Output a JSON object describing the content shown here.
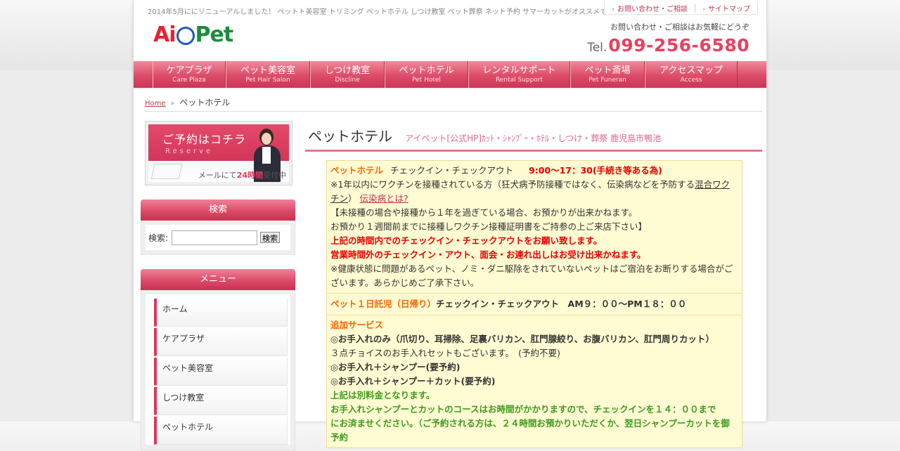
{
  "header": {
    "ticker": "2014年5月ににリニューアルしました！ ペットト美容室 トリミング ペットホテル しつけ教室 ペット葬祭 ネット予約 サマーカットがオススメです★ トリマー募集中!!",
    "links": [
      "お問い合わせ・ご相談",
      "サイトマップ"
    ],
    "logo": {
      "ai": "Ai",
      "pet": "Pet"
    },
    "contact_note": "お問い合わせ・ご相談はお気軽にどうぞ",
    "tel_label": "Tel.",
    "tel_number": "099-256-6580"
  },
  "nav": [
    {
      "jp": "ケアプラザ",
      "en": "Care Plaza"
    },
    {
      "jp": "ペット美容室",
      "en": "Pet Hair Salon"
    },
    {
      "jp": "しつけ教室",
      "en": "Discline"
    },
    {
      "jp": "ペットホテル",
      "en": "Pet Hotel"
    },
    {
      "jp": "レンタルサポート",
      "en": "Rental Support"
    },
    {
      "jp": "ペット斎場",
      "en": "Pet Funeran"
    },
    {
      "jp": "アクセスマップ",
      "en": "Access"
    }
  ],
  "breadcrumb": {
    "home": "Home",
    "separator": "»",
    "current": "ペットホテル"
  },
  "sidebar": {
    "reserve": {
      "title": "ご予約はコチラ",
      "sub": "Reserve",
      "footer_pre": "メールにて",
      "footer_hl": "24時間",
      "footer_post": "受付中"
    },
    "search": {
      "title": "検索",
      "label": "検索:",
      "button": "検索",
      "value": ""
    },
    "menu": {
      "title": "メニュー",
      "items": [
        "ホーム",
        "ケアプラザ",
        "ペット美容室",
        "しつけ教室",
        "ペットホテル"
      ]
    }
  },
  "main": {
    "title": "ペットホテル",
    "subtitle": "アイペット[公式HP]ｶｯﾄ・ｼｬﾝﾌﾟｰ・ﾎﾃﾙ・しつけ・葬祭 鹿児島市鴨池",
    "s1": {
      "label": "ペットホテル",
      "checkin": "チェックイン・チェックアウト",
      "time": "9:00～17：30(手続き等ある為)",
      "vaccine_pre": "※1年以内にワクチンを接種されている方（狂犬病予防接種ではなく、伝染病などを予防する",
      "vaccine_link": "混合ワクチン",
      "vaccine_mid": "）",
      "disease_link": "伝染病とは?",
      "line3": "【未接種の場合や接種から１年を過ぎている場合、お預かりが出来かねます。",
      "line4": "お預かり１週間前までに接種しワクチン接種証明書をご持参の上ご来店下さい】",
      "red1": "上記の時間内でのチェックイン・チェックアウトをお願い致します。",
      "red2": "営業時間外のチェックイン・アウト、面会・お連れ出しはお受け出来かねます。",
      "line7": "※健康状態に問題があるペット、ノミ・ダニ駆除をされていないペットはご宿泊をお断りする場合がございます。あらかじめご了承下さい。"
    },
    "s2": {
      "label": "ペット１日託児（日帰り）",
      "text": "チェックイン・チェックアウト　AM９：００～PM１８：００"
    },
    "s3": {
      "label": "追加サービス",
      "opt1_bold": "◎お手入れのみ",
      "opt1_rest": "（爪切り、耳掃除、足裏バリカン、肛門腺絞り、お腹バリカン、肛門周りカット）",
      "opt1_note": "３点チョイスのお手入れセットもございます。　(予約不要)",
      "opt2": "◎お手入れ＋シャンプー(要予約)",
      "opt3": "◎お手入れ＋シャンプー＋カット(要予約)",
      "green1": "上記は別料金となります。",
      "green2": "お手入れシャンプーとカットのコースはお時間がかかりますので、チェックインを１４：００まで",
      "green3": "にお済ませください。（ご予約される方は、２４時間お預かりいただくか、翌日シャンプーカットを御予約"
    }
  }
}
